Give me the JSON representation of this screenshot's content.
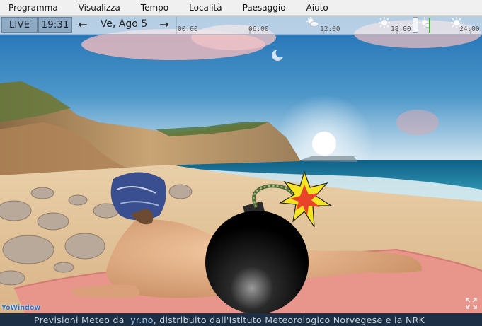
{
  "menu": {
    "items": [
      "Programma",
      "Visualizza",
      "Tempo",
      "Località",
      "Paesaggio",
      "Aiuto"
    ]
  },
  "timeline": {
    "live_label": "LIVE",
    "clock": "19:31",
    "date_label": "Ve, Ago 5",
    "prev_icon": "arrow-left-icon",
    "next_icon": "arrow-right-icon",
    "ticks": [
      "00:00",
      "06:00",
      "12:00",
      "18:00",
      "24:00"
    ],
    "weather_icons": [
      "partly-cloudy-icon",
      "sun-icon",
      "sun-icon",
      "sun-icon"
    ],
    "current_marker_color": "#3fae2a"
  },
  "footer": {
    "prefix": "Previsioni Meteo da",
    "link": "yr.no",
    "suffix": ", distribuito dall'Istituto Meteorologico Norvegese e la NRK"
  },
  "logo": {
    "text": "YoWindow"
  },
  "colors": {
    "sky_top": "#1e6fb5",
    "sky_horizon": "#cfe4f0",
    "sea": "#1c7fa0",
    "sand": "#e2c39a",
    "towel": "#e8958c",
    "footer_bg": "#1c2f44"
  }
}
